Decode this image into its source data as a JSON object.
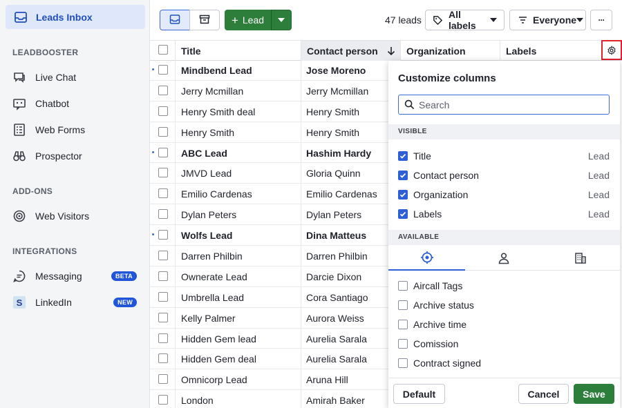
{
  "sidebar": {
    "active": {
      "label": "Leads Inbox",
      "icon": "inbox-icon"
    },
    "sections": [
      {
        "title": "LEADBOOSTER",
        "items": [
          {
            "label": "Live Chat",
            "icon": "chat-icon"
          },
          {
            "label": "Chatbot",
            "icon": "chatbot-icon"
          },
          {
            "label": "Web Forms",
            "icon": "form-icon"
          },
          {
            "label": "Prospector",
            "icon": "binoculars-icon"
          }
        ]
      },
      {
        "title": "ADD-ONS",
        "items": [
          {
            "label": "Web Visitors",
            "icon": "target-icon"
          }
        ]
      },
      {
        "title": "INTEGRATIONS",
        "items": [
          {
            "label": "Messaging",
            "icon": "message-icon",
            "badge": "BETA"
          },
          {
            "label": "LinkedIn",
            "icon": "linkedin-icon",
            "badge": "NEW"
          }
        ]
      }
    ]
  },
  "toolbar": {
    "add_lead_label": "Lead",
    "leads_count": "47 leads",
    "labels_filter": "All labels",
    "owner_filter": "Everyone",
    "more_label": "···"
  },
  "table": {
    "columns": [
      "Title",
      "Contact person",
      "Organization",
      "Labels"
    ],
    "sorted_column": "Contact person",
    "rows": [
      {
        "title": "Mindbend Lead",
        "contact": "Jose Moreno",
        "unread": true
      },
      {
        "title": "Jerry Mcmillan",
        "contact": "Jerry Mcmillan",
        "unread": false
      },
      {
        "title": "Henry Smith deal",
        "contact": "Henry Smith",
        "unread": false
      },
      {
        "title": "Henry Smith",
        "contact": "Henry Smith",
        "unread": false
      },
      {
        "title": "ABC Lead",
        "contact": "Hashim Hardy",
        "unread": true
      },
      {
        "title": "JMVD Lead",
        "contact": "Gloria Quinn",
        "unread": false
      },
      {
        "title": "Emilio Cardenas",
        "contact": "Emilio Cardenas",
        "unread": false
      },
      {
        "title": "Dylan Peters",
        "contact": "Dylan Peters",
        "unread": false
      },
      {
        "title": "Wolfs Lead",
        "contact": "Dina Matteus",
        "unread": true
      },
      {
        "title": "Darren Philbin",
        "contact": "Darren Philbin",
        "unread": false
      },
      {
        "title": "Ownerate Lead",
        "contact": "Darcie Dixon",
        "unread": false
      },
      {
        "title": "Umbrella Lead",
        "contact": "Cora Santiago",
        "unread": false
      },
      {
        "title": "Kelly Palmer",
        "contact": "Aurora Weiss",
        "unread": false
      },
      {
        "title": "Hidden Gem lead",
        "contact": "Aurelia Sarala",
        "unread": false
      },
      {
        "title": "Hidden Gem deal",
        "contact": "Aurelia Sarala",
        "unread": false
      },
      {
        "title": "Omnicorp Lead",
        "contact": "Aruna Hill",
        "unread": false
      },
      {
        "title": "London",
        "contact": "Amirah Baker",
        "unread": false
      }
    ]
  },
  "customize": {
    "title": "Customize columns",
    "search_placeholder": "Search",
    "visible_title": "VISIBLE",
    "visible": [
      {
        "label": "Title",
        "tag": "Lead",
        "checked": true
      },
      {
        "label": "Contact person",
        "tag": "Lead",
        "checked": true
      },
      {
        "label": "Organization",
        "tag": "Lead",
        "checked": true
      },
      {
        "label": "Labels",
        "tag": "Lead",
        "checked": true
      }
    ],
    "available_title": "AVAILABLE",
    "tabs": [
      {
        "icon": "crosshair-icon",
        "active": true
      },
      {
        "icon": "person-icon",
        "active": false
      },
      {
        "icon": "building-icon",
        "active": false
      }
    ],
    "available": [
      {
        "label": "Aircall Tags",
        "checked": false
      },
      {
        "label": "Archive status",
        "checked": false
      },
      {
        "label": "Archive time",
        "checked": false
      },
      {
        "label": "Comission",
        "checked": false
      },
      {
        "label": "Contract signed",
        "checked": false
      }
    ],
    "default_label": "Default",
    "cancel_label": "Cancel",
    "save_label": "Save"
  },
  "colors": {
    "accent": "#2d5fd6",
    "primary_green": "#2d7d3b",
    "highlight_red": "#e0202a"
  }
}
